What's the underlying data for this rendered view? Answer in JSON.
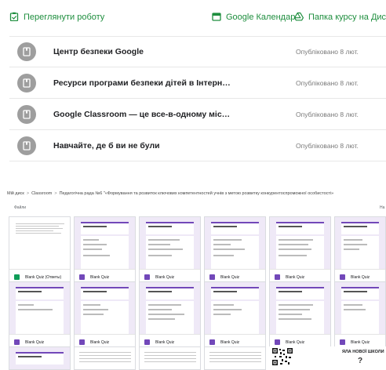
{
  "toolbar": {
    "view_work_label": "Переглянути роботу",
    "calendar_label": "Google Календар",
    "drive_folder_label": "Папка курсу на Диску"
  },
  "materials": [
    {
      "title": "Центр безпеки Google",
      "date": "Опубліковано 8 лют."
    },
    {
      "title": "Ресурси програми безпеки дітей в Інтерн…",
      "date": "Опубліковано 8 лют."
    },
    {
      "title": "Google Classroom — це все-в-одному міс…",
      "date": "Опубліковано 8 лют."
    },
    {
      "title": "Навчайте, де б ви не були",
      "date": "Опубліковано 8 лют."
    }
  ],
  "drive": {
    "breadcrumb": [
      "Мій диск",
      "Classroom",
      "Педагогічна рада №6 \"«Формування та розвиток ключових компетентностей учнів з метою розвитку конкурентоспроможної особистості»"
    ],
    "files_label": "Файли",
    "files_right_label": "На"
  },
  "files": [
    {
      "name": "Blank Quiz (Ответы)",
      "kind": "sheet"
    },
    {
      "name": "Blank Quiz",
      "kind": "form"
    },
    {
      "name": "Blank Quiz",
      "kind": "form"
    },
    {
      "name": "Blank Quiz",
      "kind": "form"
    },
    {
      "name": "Blank Quiz",
      "kind": "form"
    },
    {
      "name": "Blank Quiz",
      "kind": "form"
    },
    {
      "name": "Blank Quiz",
      "kind": "form"
    },
    {
      "name": "Blank Quiz",
      "kind": "form"
    },
    {
      "name": "Blank Quiz",
      "kind": "form"
    },
    {
      "name": "Blank Quiz",
      "kind": "form"
    },
    {
      "name": "Blank Quiz",
      "kind": "form"
    },
    {
      "name": "Blank Quiz",
      "kind": "form"
    }
  ],
  "bottom_tile_text": "ЯЛА НОВОЇ ШКОЛИ",
  "bottom_tile_mark": "?",
  "colors": {
    "accent_green": "#1e8e3e",
    "form_purple": "#7248b9",
    "sheet_green": "#0f9d58",
    "material_icon_gray": "#9e9e9e"
  },
  "icons": {
    "view_work": "assignment-icon",
    "calendar": "calendar-icon",
    "drive_folder": "drive-icon",
    "material": "material-icon"
  }
}
